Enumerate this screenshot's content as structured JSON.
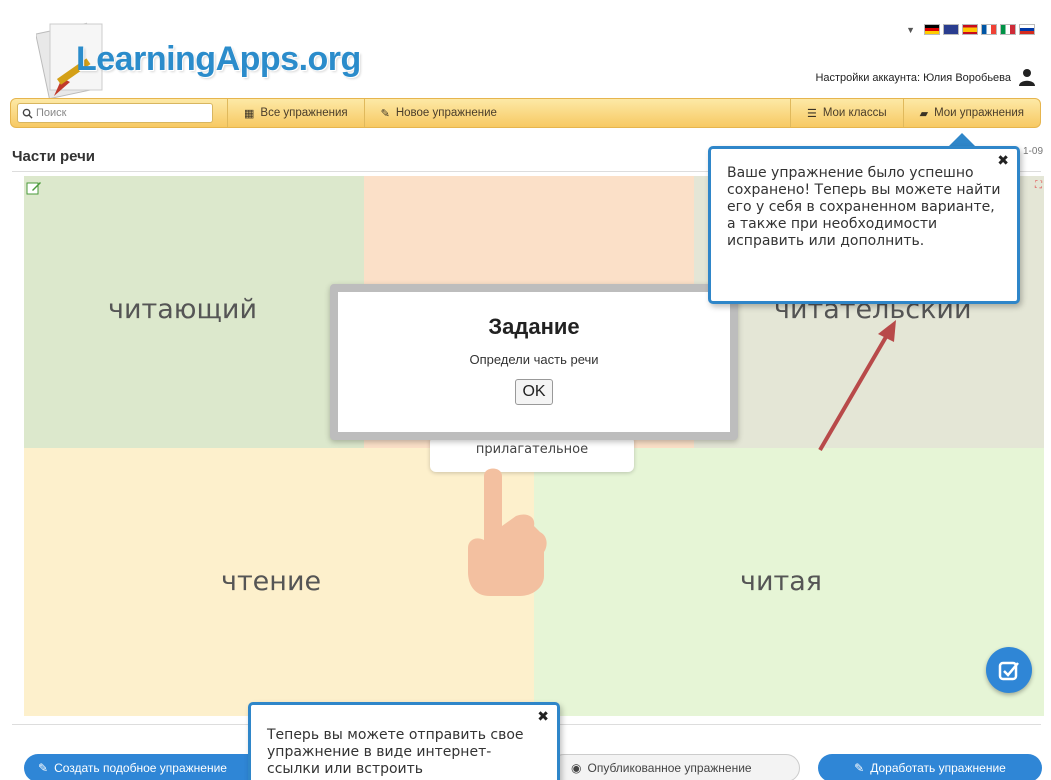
{
  "header": {
    "logo_text": "LearningApps.org",
    "account_label": "Настройки аккаунта: Юлия Воробьева"
  },
  "nav": {
    "search_placeholder": "Поиск",
    "all_exercises": "Все упражнения",
    "new_exercise": "Новое упражнение",
    "my_classes": "Мои классы",
    "my_exercises": "Мои упражнения"
  },
  "exercise": {
    "title": "Части речи",
    "date_fragment": "1-09",
    "words": [
      "читающий",
      "читательский",
      "чтение",
      "читая"
    ],
    "card_text": "прилагательное"
  },
  "modal": {
    "title": "Задание",
    "text": "Определи часть речи",
    "ok_label": "OK"
  },
  "tooltips": {
    "saved": "Ваше упражнение было успешно сохранено! Теперь вы можете найти его у себя в сохраненном варианте, а также при необходимости исправить или дополнить.",
    "share": "Теперь вы можете отправить свое упражнение в виде интернет-ссылки или встроить"
  },
  "buttons": {
    "create_similar": "Создать подобное упражнение",
    "published": "Опубликованное упражнение",
    "improve": "Доработать упражнение"
  },
  "colors": {
    "accent_blue": "#2f86d6",
    "nav_yellow": "#f7c963"
  }
}
